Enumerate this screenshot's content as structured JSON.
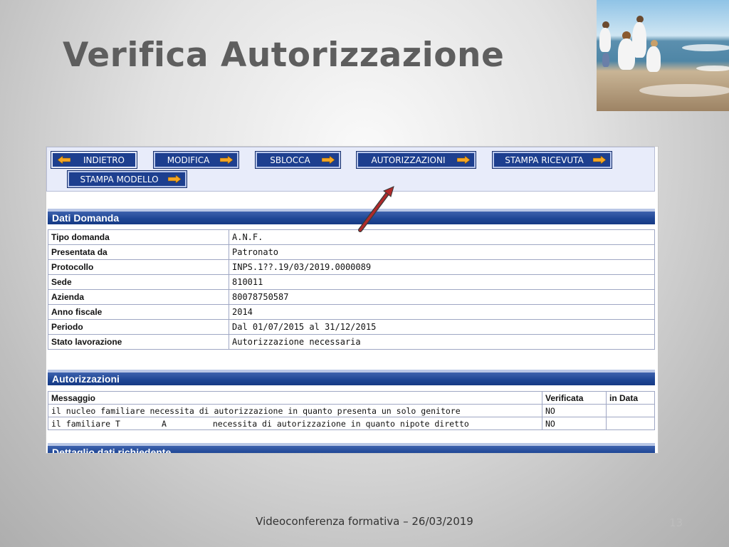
{
  "slide": {
    "title": "Verifica Autorizzazione",
    "footer": "Videoconferenza formativa – 26/03/2019",
    "page_number": "13"
  },
  "toolbar": {
    "buttons": [
      {
        "label": "INDIETRO",
        "icon": "arrow-left-icon"
      },
      {
        "label": "MODIFICA",
        "icon": "arrow-right-icon"
      },
      {
        "label": "SBLOCCA",
        "icon": "arrow-right-icon"
      },
      {
        "label": "AUTORIZZAZIONI",
        "icon": "arrow-right-icon"
      },
      {
        "label": "STAMPA RICEVUTA",
        "icon": "arrow-right-icon"
      },
      {
        "label": "STAMPA MODELLO",
        "icon": "arrow-right-icon"
      }
    ]
  },
  "dati_domanda": {
    "title": "Dati Domanda",
    "rows": [
      {
        "label": "Tipo domanda",
        "value": "A.N.F."
      },
      {
        "label": "Presentata da",
        "value": "Patronato"
      },
      {
        "label": "Protocollo",
        "value": "INPS.1??.19/03/2019.0000089"
      },
      {
        "label": "Sede",
        "value": "810011"
      },
      {
        "label": "Azienda",
        "value": "80078750587"
      },
      {
        "label": "Anno fiscale",
        "value": "2014"
      },
      {
        "label": "Periodo",
        "value": "Dal 01/07/2015 al 31/12/2015"
      },
      {
        "label": "Stato lavorazione",
        "value": "Autorizzazione necessaria"
      }
    ]
  },
  "autorizzazioni": {
    "title": "Autorizzazioni",
    "headers": [
      "Messaggio",
      "Verificata",
      "in Data"
    ],
    "rows": [
      {
        "messaggio": "il nucleo familiare necessita di autorizzazione in quanto presenta un solo genitore",
        "verificata": "NO",
        "in_data": ""
      },
      {
        "messaggio_prefix": "il familiare T",
        "messaggio_mid": "A",
        "messaggio_suffix": "necessita di autorizzazione in quanto nipote diretto",
        "verificata": "NO",
        "in_data": ""
      }
    ]
  },
  "next_section": {
    "title": "Dettaglio dati richiedente"
  },
  "colors": {
    "section_bar": "#1f4796",
    "button_bg": "#1d3f8f",
    "arrow_icon": "#f5a623",
    "callout_arrow": "#b02a2a"
  }
}
